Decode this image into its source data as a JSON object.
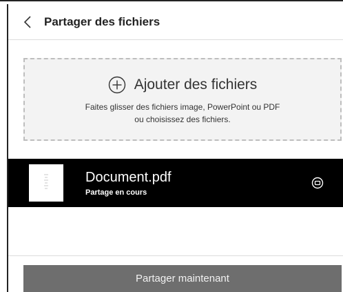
{
  "header": {
    "title": "Partager des fichiers",
    "back_icon": "chevron-left-icon"
  },
  "dropzone": {
    "add_label": "Ajouter des fichiers",
    "add_icon": "plus-circle-icon",
    "hint_line1": "Faites glisser des fichiers image, PowerPoint ou PDF",
    "hint_line2": "ou choisissez des fichiers."
  },
  "file": {
    "name": "Document.pdf",
    "status": "Partage en cours",
    "thumbnail_icon": "document-thumbnail-icon",
    "stop_icon": "stop-icon"
  },
  "footer": {
    "share_button_label": "Partager maintenant"
  },
  "colors": {
    "file_row_bg": "#000000",
    "button_bg": "#6e6e6e",
    "dropzone_bg": "#f3f3f3"
  }
}
